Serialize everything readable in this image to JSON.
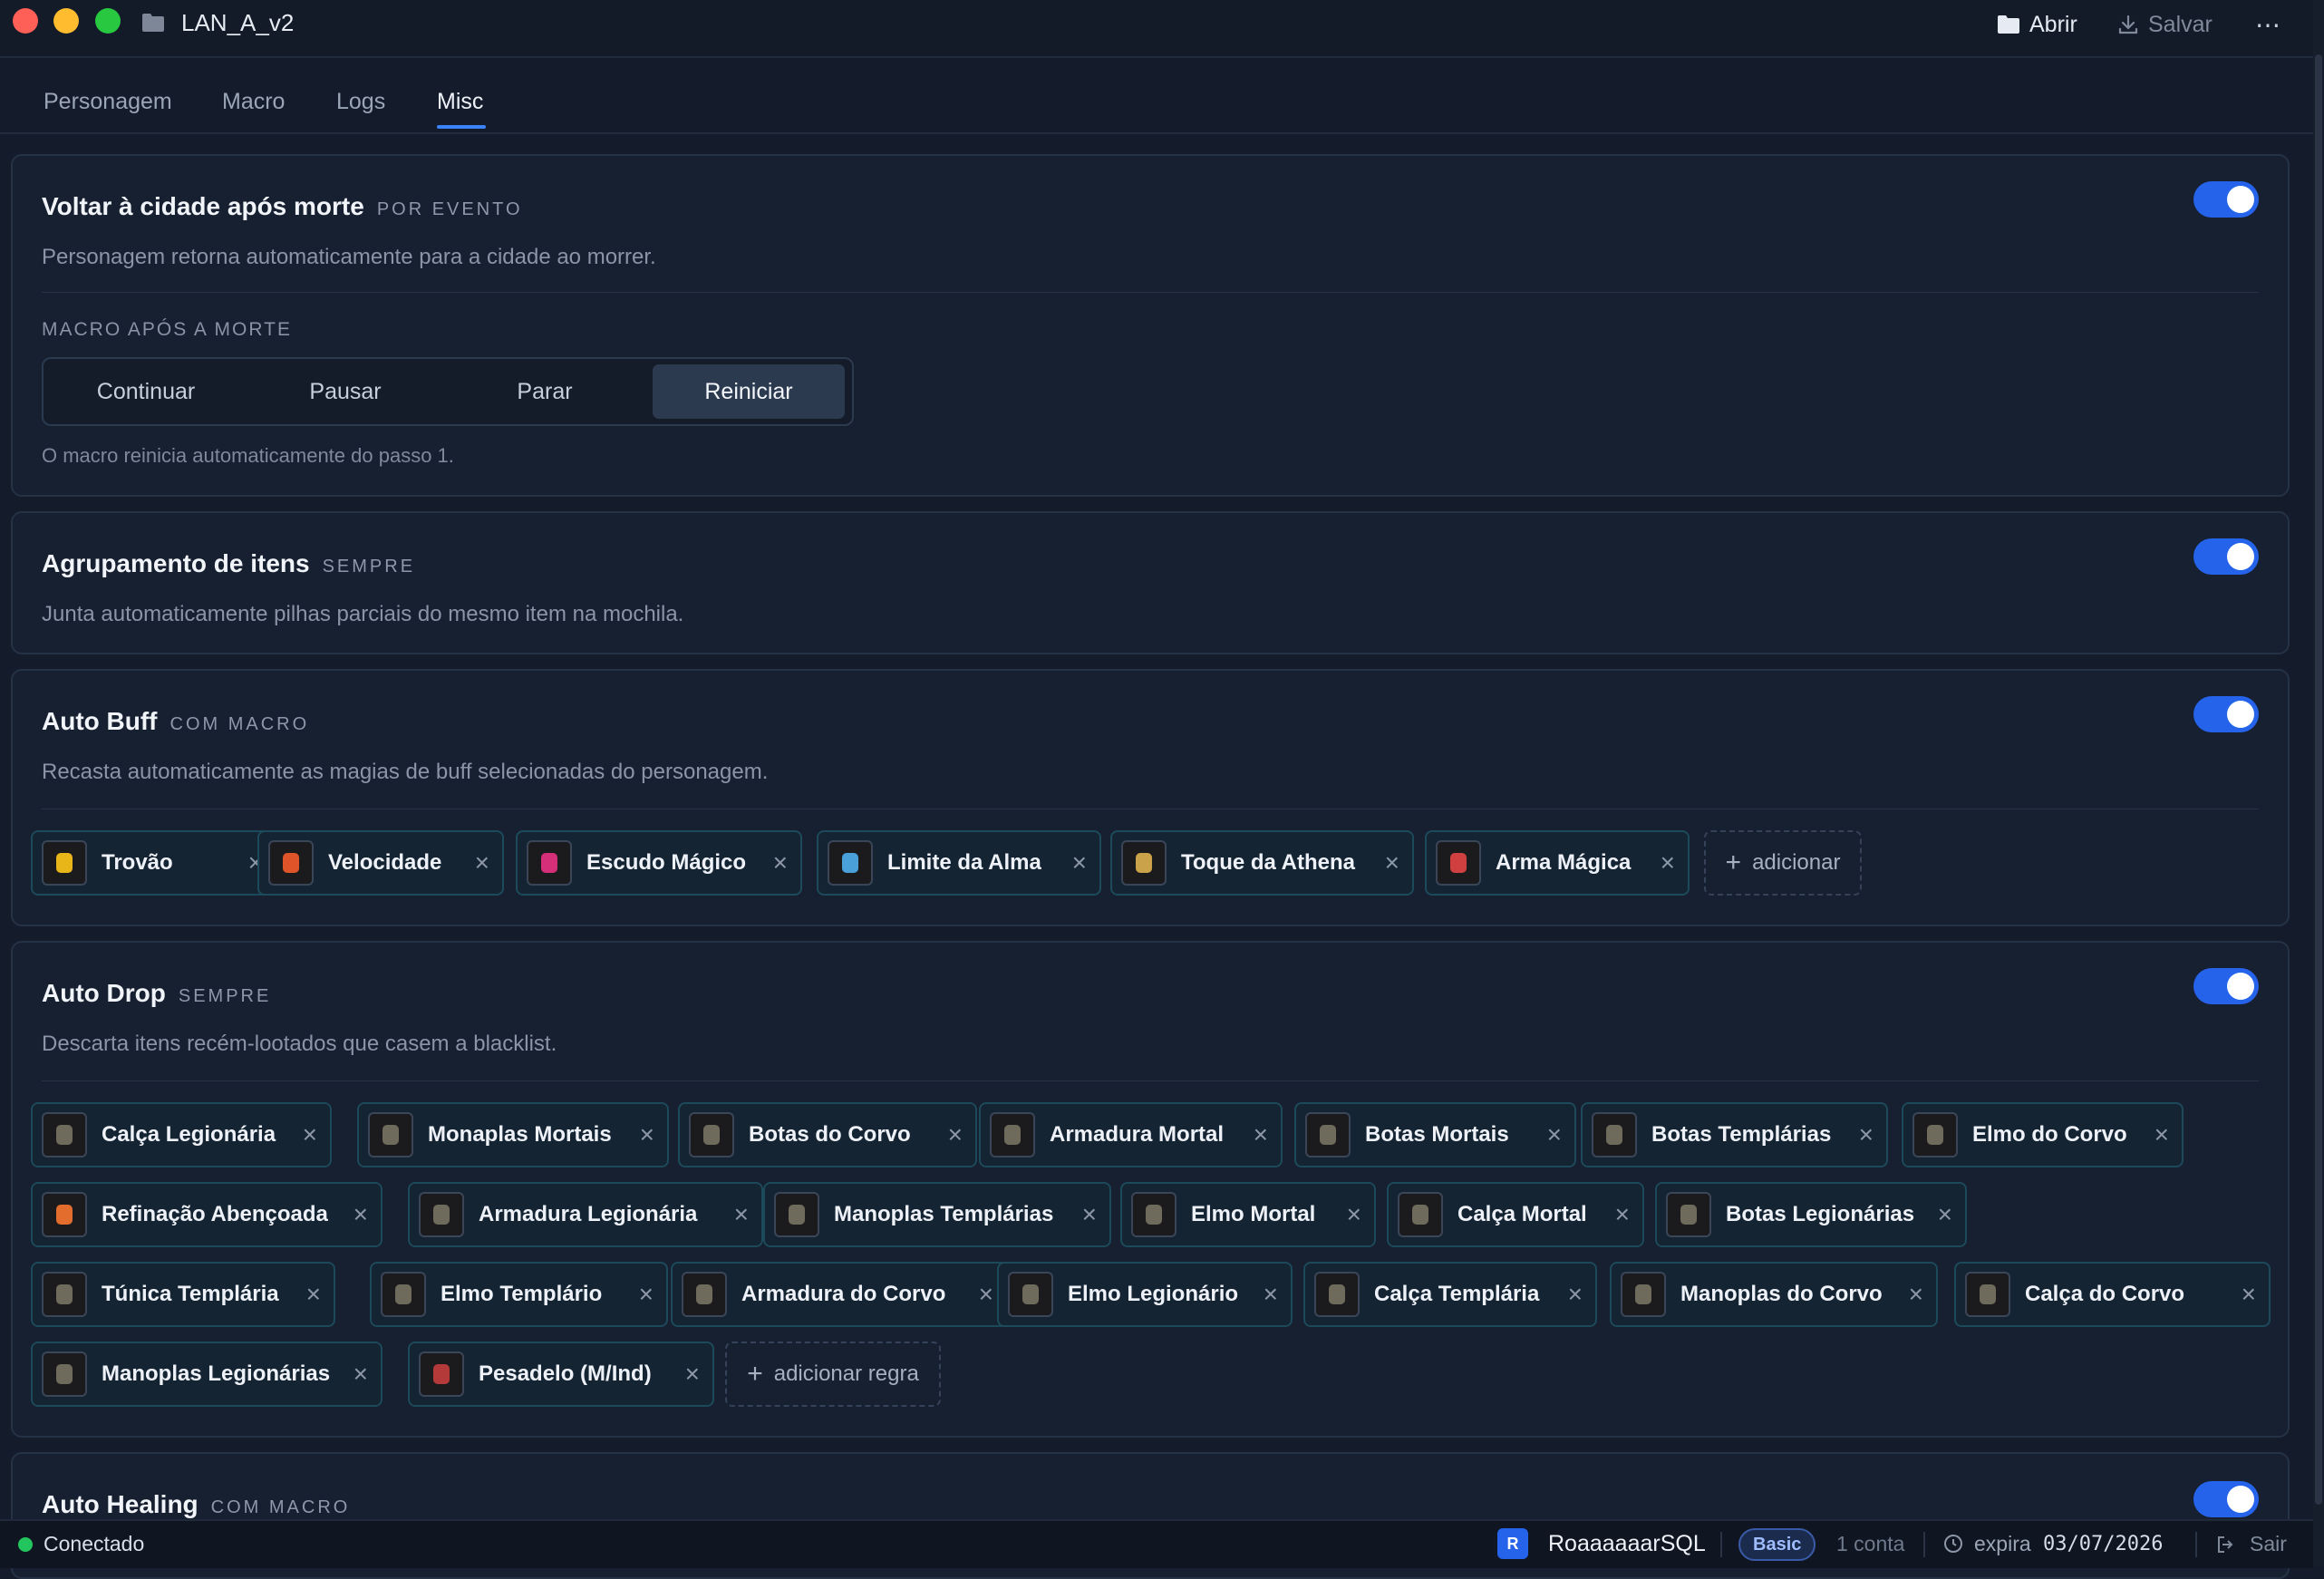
{
  "window": {
    "title": "LAN_A_v2",
    "open_label": "Abrir",
    "save_label": "Salvar",
    "more_label": "⋯"
  },
  "tabs": [
    "Personagem",
    "Macro",
    "Logs",
    "Misc"
  ],
  "sections": {
    "death": {
      "title": "Voltar à cidade após morte",
      "tag": "POR EVENTO",
      "desc": "Personagem retorna automaticamente para a cidade ao morrer.",
      "macro_label": "MACRO APÓS A MORTE",
      "options": [
        "Continuar",
        "Pausar",
        "Parar",
        "Reiniciar"
      ],
      "selected": "Reiniciar",
      "note": "O macro reinicia automaticamente do passo 1.",
      "enabled": true
    },
    "grouping": {
      "title": "Agrupamento de itens",
      "tag": "SEMPRE",
      "desc": "Junta automaticamente pilhas parciais do mesmo item na mochila.",
      "enabled": true
    },
    "buff": {
      "title": "Auto Buff",
      "tag": "COM MACRO",
      "desc": "Recasta automaticamente as magias de buff selecionadas do personagem.",
      "items": [
        "Trovão",
        "Velocidade",
        "Escudo Mágico",
        "Limite da Alma",
        "Toque da Athena",
        "Arma Mágica"
      ],
      "add_label": "adicionar",
      "enabled": true
    },
    "drop": {
      "title": "Auto Drop",
      "tag": "SEMPRE",
      "desc": "Descarta itens recém-lootados que casem a blacklist.",
      "items": [
        "Calça Legionária",
        "Monaplas Mortais",
        "Botas do Corvo",
        "Armadura Mortal",
        "Botas Mortais",
        "Botas Templárias",
        "Elmo do Corvo",
        "Refinação Abençoada",
        "Armadura Legionária",
        "Manoplas Templárias",
        "Elmo Mortal",
        "Calça Mortal",
        "Botas Legionárias",
        "Túnica Templária",
        "Elmo Templário",
        "Armadura do Corvo",
        "Elmo Legionário",
        "Calça Templária",
        "Manoplas do Corvo",
        "Calça do Corvo",
        "Manoplas Legionárias",
        "Pesadelo (M/Ind)"
      ],
      "add_label": "adicionar regra",
      "enabled": true
    },
    "healing": {
      "title": "Auto Healing",
      "tag": "COM MACRO",
      "enabled": true
    }
  },
  "status": {
    "connection": "Conectado",
    "avatar_letter": "R",
    "user": "RoaaaaaarSQL",
    "plan": "Basic",
    "accounts": "1 conta",
    "expires_label": "expira",
    "expires_date": "03/07/2026",
    "logout": "Sair"
  },
  "colors": {
    "background": "#141c2b",
    "accent": "#2563eb",
    "connected": "#22c55e"
  }
}
